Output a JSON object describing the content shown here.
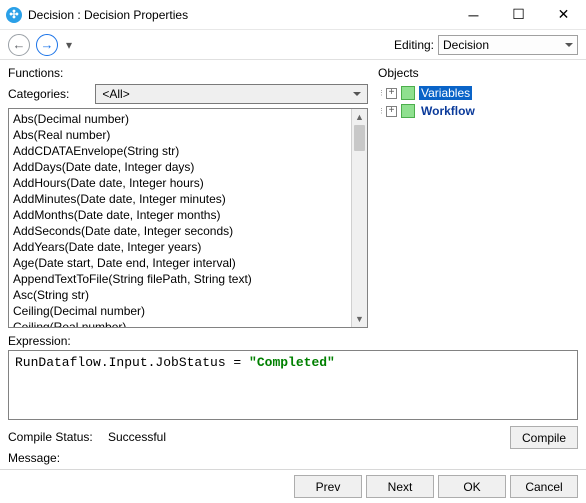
{
  "window": {
    "title": "Decision : Decision Properties"
  },
  "toolbar": {
    "editing_label": "Editing:",
    "editing_value": "Decision"
  },
  "functions": {
    "label": "Functions:",
    "categories_label": "Categories:",
    "categories_value": "<All>",
    "items": [
      "Abs(Decimal number)",
      "Abs(Real number)",
      "AddCDATAEnvelope(String str)",
      "AddDays(Date date, Integer days)",
      "AddHours(Date date, Integer hours)",
      "AddMinutes(Date date, Integer minutes)",
      "AddMonths(Date date, Integer months)",
      "AddSeconds(Date date, Integer seconds)",
      "AddYears(Date date, Integer years)",
      "Age(Date start, Date end, Integer interval)",
      "AppendTextToFile(String filePath, String text)",
      "Asc(String str)",
      "Ceiling(Decimal number)",
      "Ceiling(Real number)"
    ]
  },
  "objects": {
    "label": "Objects",
    "nodes": {
      "variables": "Variables",
      "workflow": "Workflow"
    }
  },
  "expression": {
    "label": "Expression:",
    "prefix": "RunDataflow.Input.JobStatus = ",
    "string": "\"Completed\""
  },
  "status": {
    "compile_label": "Compile Status:",
    "compile_value": "Successful",
    "message_label": "Message:",
    "compile_button": "Compile"
  },
  "footer": {
    "prev": "Prev",
    "next": "Next",
    "ok": "OK",
    "cancel": "Cancel"
  }
}
